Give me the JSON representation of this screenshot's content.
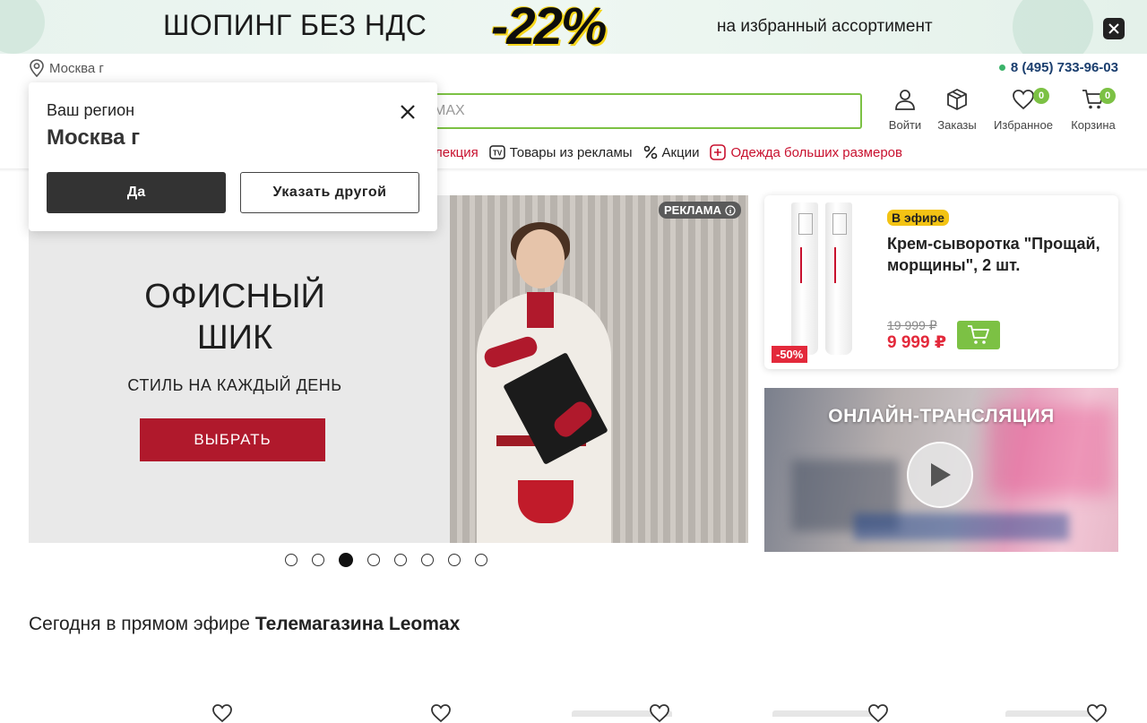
{
  "promo": {
    "left_text": "ШОПИНГ БЕЗ НДС",
    "discount": "-22%",
    "right_text": "на избранный ассортимент"
  },
  "header": {
    "city": "Москва г",
    "phone": "8 (495) 733-96-03",
    "search_placeholder": "MAX",
    "nav": [
      {
        "label": "Войти",
        "icon": "user-icon"
      },
      {
        "label": "Заказы",
        "icon": "box-icon"
      },
      {
        "label": "Избранное",
        "icon": "heart-icon",
        "badge": "0"
      },
      {
        "label": "Корзина",
        "icon": "cart-icon",
        "badge": "0"
      }
    ],
    "categories": [
      {
        "label": "лекция",
        "color": "red"
      },
      {
        "label": "Товары из рекламы",
        "icon": "tv-icon"
      },
      {
        "label": "Акции",
        "icon": "percent-icon"
      },
      {
        "label": "Одежда больших размеров",
        "icon": "plus-box-icon",
        "color": "red"
      }
    ]
  },
  "hero": {
    "ad_label": "РЕКЛАМА",
    "title": "ОФИСНЫЙ ШИК",
    "subtitle": "СТИЛЬ НА КАЖДЫЙ ДЕНЬ",
    "button": "ВЫБРАТЬ",
    "slides_total": 8,
    "active_slide": 3
  },
  "product": {
    "on_air": "В эфире",
    "title": "Крем-сыворотка \"Прощай, морщины\", 2 шт.",
    "old_price": "19 999 ₽",
    "new_price": "9 999 ₽",
    "discount": "-50%"
  },
  "live": {
    "title": "ОНЛАЙН-ТРАНСЛЯЦИЯ"
  },
  "section": {
    "title_prefix": "Сегодня в прямом эфире ",
    "title_bold": "Телемагазина Leomax"
  },
  "popup": {
    "question": "Ваш регион",
    "city": "Москва г",
    "yes": "Да",
    "other": "Указать другой"
  },
  "colors": {
    "accent_green": "#7cc144",
    "brand_red": "#c8102e",
    "dark_button": "#333333",
    "phone_blue": "#1a3e6e"
  }
}
